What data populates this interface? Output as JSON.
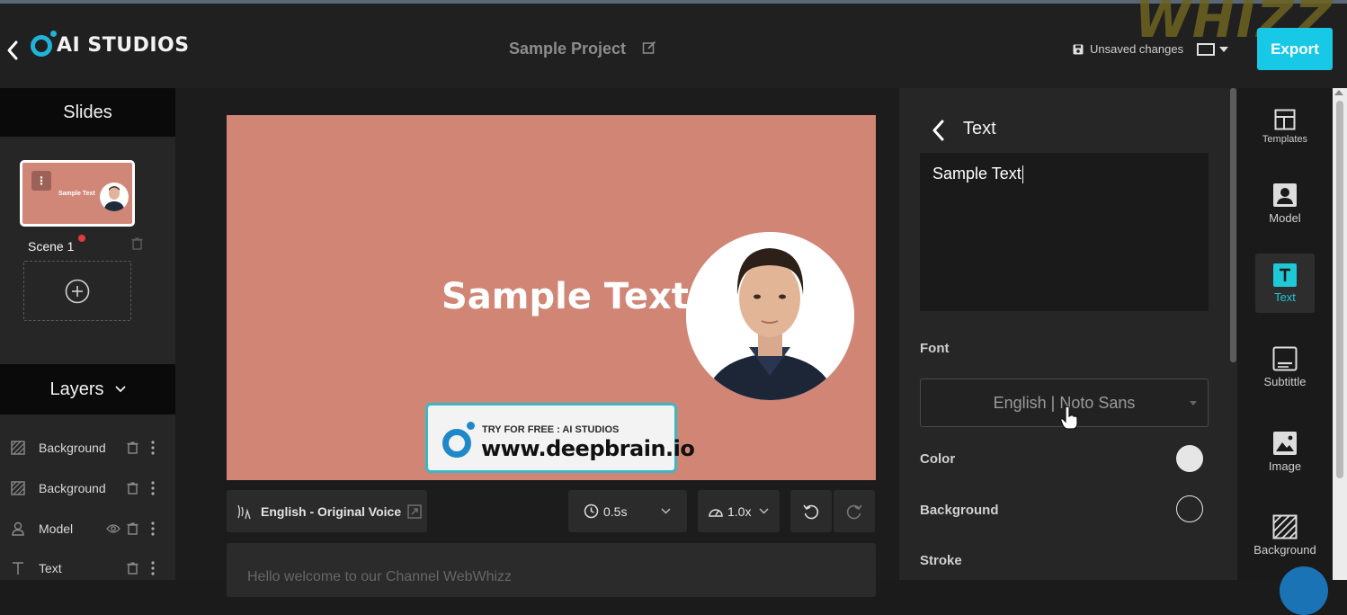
{
  "header": {
    "brand": "AI STUDIOS",
    "project_title": "Sample Project",
    "watermark": "WHIZZ",
    "unsaved_label": "Unsaved changes",
    "export_label": "Export"
  },
  "slides_panel": {
    "title": "Slides",
    "scenes": [
      {
        "label": "Scene 1",
        "thumb_text": "Sample Text"
      }
    ]
  },
  "layers_panel": {
    "title": "Layers",
    "items": [
      {
        "label": "Background",
        "icon": "hatch-icon"
      },
      {
        "label": "Background",
        "icon": "hatch-icon"
      },
      {
        "label": "Model",
        "icon": "person-icon"
      },
      {
        "label": "Text",
        "icon": "text-t-icon"
      }
    ]
  },
  "canvas": {
    "main_text": "Sample Text",
    "promo_line1": "TRY FOR FREE : AI STUDIOS",
    "promo_line2": "www.deepbrain.io",
    "background_color": "#d08575"
  },
  "controls": {
    "voice_label": "English - Original Voice",
    "pause_value": "0.5s",
    "speed_value": "1.0x"
  },
  "script": {
    "text": "Hello welcome to our Channel WebWhizz"
  },
  "properties": {
    "title": "Text",
    "text_value": "Sample Text",
    "font_label": "Font",
    "font_value": "English | Noto Sans",
    "color_label": "Color",
    "color_value": "#e6e6e6",
    "background_label": "Background",
    "stroke_label": "Stroke"
  },
  "toolbar": {
    "items": [
      {
        "label": "Templates",
        "icon": "templates-icon"
      },
      {
        "label": "Model",
        "icon": "model-icon"
      },
      {
        "label": "Text",
        "icon": "text-icon",
        "active": true
      },
      {
        "label": "Subtittle",
        "icon": "subtitle-icon"
      },
      {
        "label": "Image",
        "icon": "image-icon"
      },
      {
        "label": "Background",
        "icon": "background-icon"
      }
    ]
  },
  "colors": {
    "accent": "#17c9e6",
    "brand_blue": "#1fb3d8",
    "active_tool": "#1fc8d6"
  }
}
